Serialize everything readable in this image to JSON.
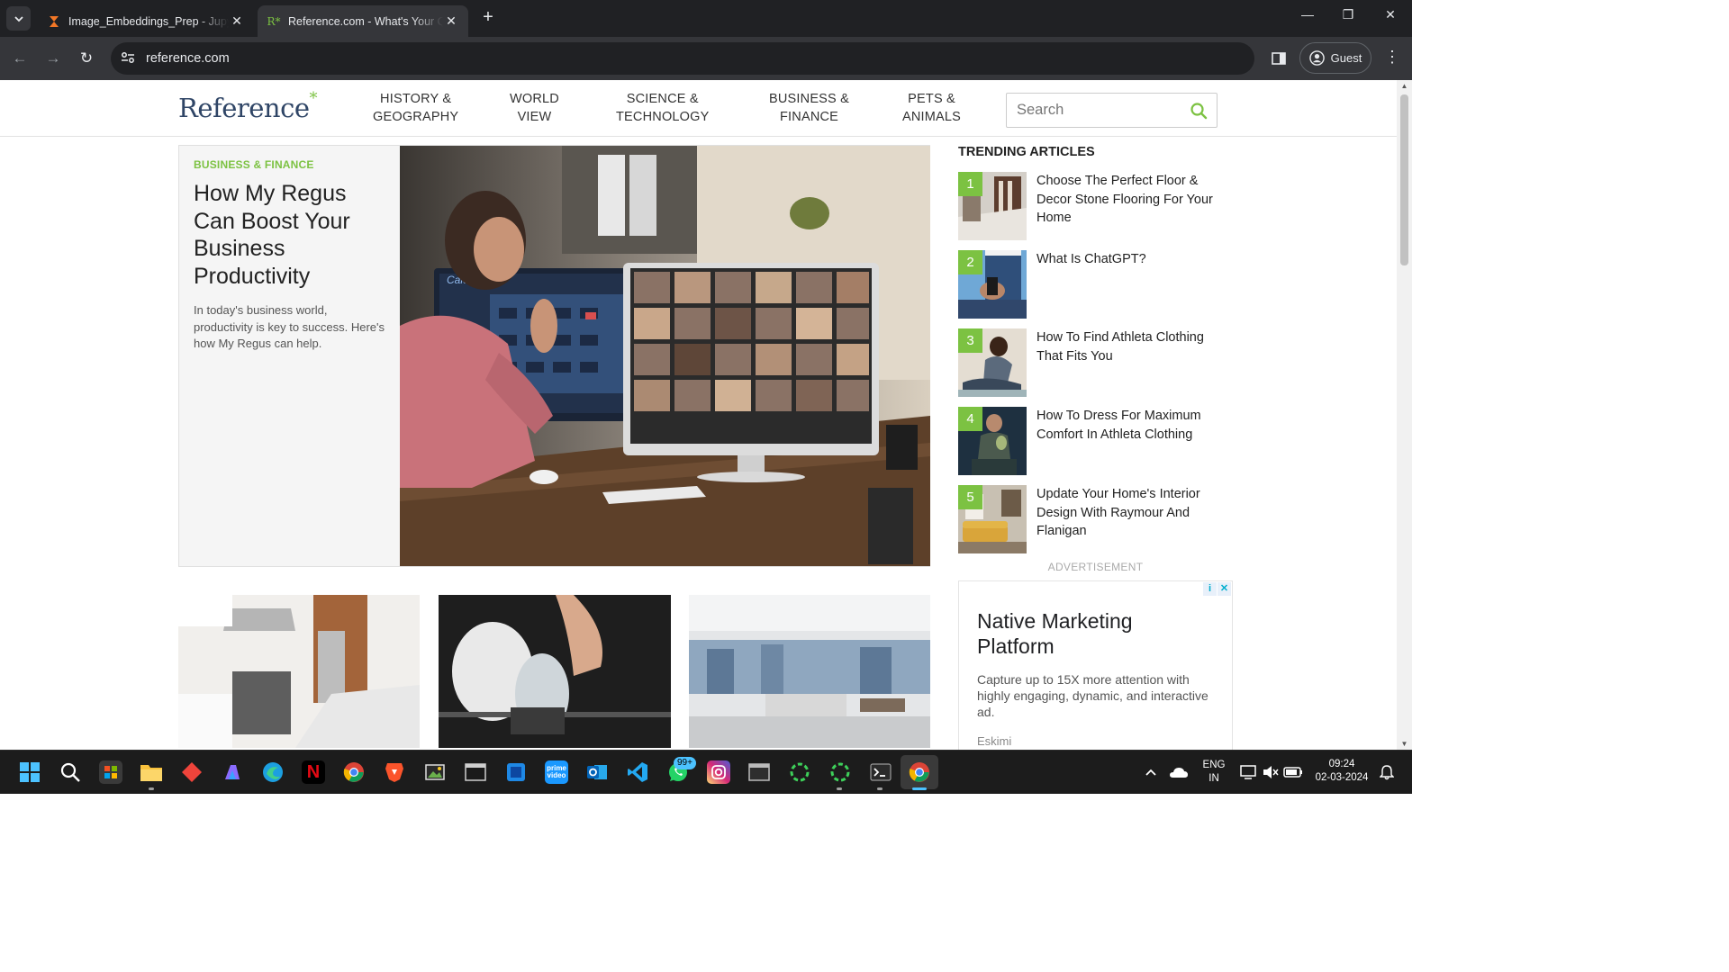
{
  "browser": {
    "tabs": [
      {
        "title": "Image_Embeddings_Prep - Jupyter",
        "favicon": "hourglass-icon",
        "active": false
      },
      {
        "title": "Reference.com - What's Your Question?",
        "favicon": "reference-favicon",
        "active": true
      }
    ],
    "url": "reference.com",
    "profile_label": "Guest"
  },
  "site": {
    "logo": "Reference",
    "logo_mark": "*",
    "nav": [
      {
        "line1": "HISTORY &",
        "line2": "GEOGRAPHY"
      },
      {
        "line1": "WORLD",
        "line2": "VIEW"
      },
      {
        "line1": "SCIENCE &",
        "line2": "TECHNOLOGY"
      },
      {
        "line1": "BUSINESS &",
        "line2": "FINANCE"
      },
      {
        "line1": "PETS &",
        "line2": "ANIMALS"
      }
    ],
    "search_placeholder": "Search",
    "accent_color": "#7cc242"
  },
  "hero": {
    "category": "BUSINESS & FINANCE",
    "title": "How My Regus Can Boost Your Business Productivity",
    "description": "In today's business world, productivity is key to success. Here's how My Regus can help.",
    "image_calendar_label": "Calendar"
  },
  "trending": {
    "heading": "TRENDING ARTICLES",
    "items": [
      {
        "num": "1",
        "title": "Choose The Perfect Floor & Decor Stone Flooring For Your Home"
      },
      {
        "num": "2",
        "title": "What Is ChatGPT?"
      },
      {
        "num": "3",
        "title": "How To Find Athleta Clothing That Fits You"
      },
      {
        "num": "4",
        "title": "How To Dress For Maximum Comfort In Athleta Clothing"
      },
      {
        "num": "5",
        "title": "Update Your Home's Interior Design With Raymour And Flanigan"
      }
    ]
  },
  "ad": {
    "label": "ADVERTISEMENT",
    "title": "Native Marketing Platform",
    "description": "Capture up to 15X more attention with highly engaging, dynamic, and interactive ad.",
    "brand": "Eskimi"
  },
  "taskbar": {
    "whatsapp_badge": "99+",
    "language_line1": "ENG",
    "language_line2": "IN",
    "time": "09:24",
    "date": "02-03-2024"
  }
}
